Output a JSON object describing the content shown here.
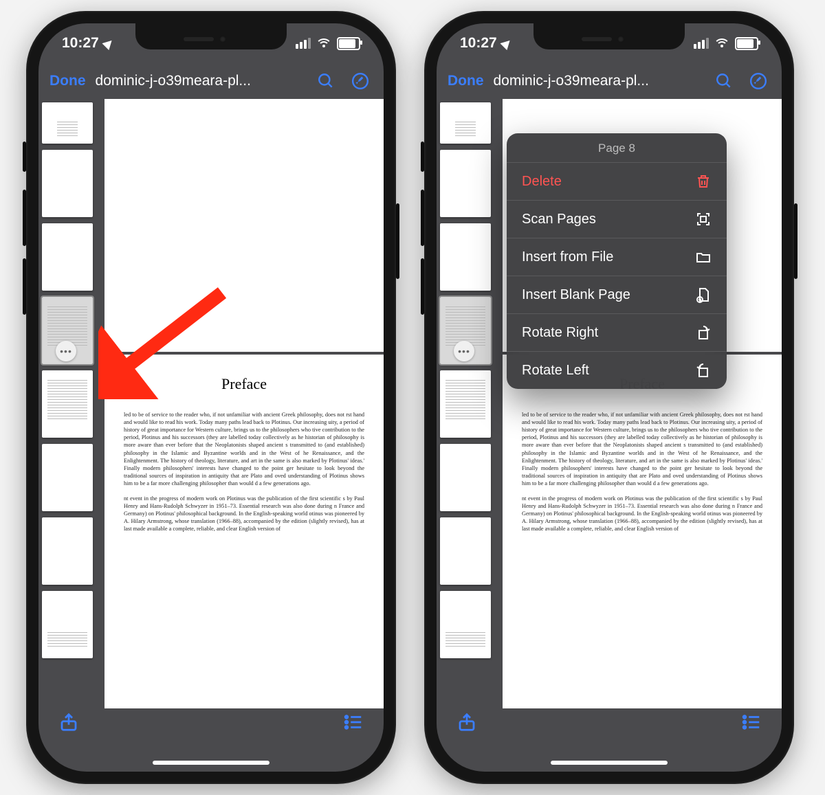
{
  "clock": "10:27",
  "nav": {
    "done": "Done",
    "title": "dominic-j-o39meara-pl..."
  },
  "preface": {
    "heading": "Preface",
    "p1": "led to be of service to the reader who, if not unfamiliar with ancient Greek philosophy, does not rst hand and would like to read his work. Today many paths lead back to Plotinus. Our increasing uity, a period of history of great importance for Western culture, brings us to the philosophers who tive contribution to the period, Plotinus and his successors (they are labelled today collectively as he historian of philosophy is more aware than ever before that the Neoplatonists shaped ancient s transmitted to (and established) philosophy in the Islamic and Byzantine worlds and in the West of he Renaissance, and the Enlightenment. The history of theology, literature, and art in the same is also marked by Plotinus' ideas.' Finally modern philosophers' interests have changed to the point ger hesitate to look beyond the traditional sources of inspiration in antiquity that are Plato and oved understanding of Plotinus shows him to be a far more challenging philosopher than would d a few generations ago.",
    "p2": "nt event in the progress of modern work on Plotinus was the publication of the first scientific s by Paul Henry and Hans-Rudolph Schwyzer in 1951–73. Essential research was also done during n France and Germany) on Plotinus' philosophical background. In the English-speaking world otinus was pioneered by A. Hilary Armstrong, whose translation (1966–88), accompanied by the edition (slightly revised), has at last made available a complete, reliable, and clear English version of"
  },
  "menu": {
    "header": "Page 8",
    "delete": "Delete",
    "scan": "Scan Pages",
    "insertFile": "Insert from File",
    "insertBlank": "Insert Blank Page",
    "rotateRight": "Rotate Right",
    "rotateLeft": "Rotate Left"
  }
}
